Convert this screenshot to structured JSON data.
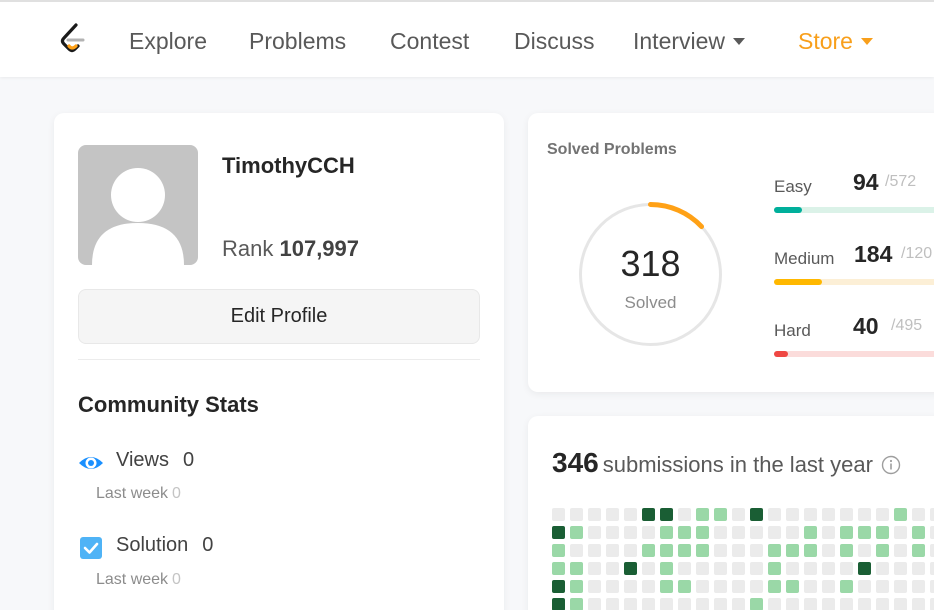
{
  "nav": {
    "items": [
      "Explore",
      "Problems",
      "Contest",
      "Discuss",
      "Interview",
      "Store"
    ],
    "accent": "#f89f1b"
  },
  "profile": {
    "username": "TimothyCCH",
    "rank_label": "Rank",
    "rank_value": "107,997",
    "edit_label": "Edit Profile"
  },
  "community": {
    "title": "Community Stats",
    "stats": [
      {
        "label": "Views",
        "value": "0",
        "sub_label": "Last week",
        "sub_value": "0",
        "icon": "eye-icon",
        "color": "#1a90ff"
      },
      {
        "label": "Solution",
        "value": "0",
        "sub_label": "Last week",
        "sub_value": "0",
        "icon": "checkbox-icon",
        "color": "#4fb3f6"
      }
    ]
  },
  "solved": {
    "title": "Solved Problems",
    "total": "318",
    "total_label": "Solved",
    "ring_fraction": 0.13,
    "ring_color": "#ffa116",
    "difficulties": [
      {
        "label": "Easy",
        "count": "94",
        "total": "/572",
        "fraction": 0.165,
        "color": "#00af9b",
        "track": "#dbf2e8"
      },
      {
        "label": "Medium",
        "count": "184",
        "total": "/120",
        "fraction": 0.28,
        "color": "#ffb800",
        "track": "#fcefd6"
      },
      {
        "label": "Hard",
        "count": "40",
        "total": "/495",
        "fraction": 0.081,
        "color": "#ef4743",
        "track": "#fbdcdb"
      }
    ]
  },
  "submissions": {
    "count": "346",
    "text": "submissions in the last year",
    "levels": [
      "#ebebeb",
      "#9ad8a7",
      "#1a5e34"
    ],
    "weeks": [
      [
        0,
        2,
        1,
        1,
        2,
        2,
        1
      ],
      [
        0,
        1,
        0,
        1,
        1,
        1,
        1
      ],
      [
        0,
        0,
        0,
        0,
        0,
        0,
        0
      ],
      [
        0,
        0,
        0,
        0,
        0,
        0,
        0
      ],
      [
        0,
        0,
        0,
        2,
        0,
        0,
        0
      ],
      [
        2,
        0,
        1,
        0,
        0,
        0,
        0
      ],
      [
        2,
        1,
        1,
        1,
        1,
        0,
        0
      ],
      [
        0,
        1,
        1,
        0,
        1,
        0,
        0
      ],
      [
        1,
        1,
        1,
        0,
        0,
        0,
        0
      ],
      [
        1,
        0,
        0,
        0,
        0,
        0,
        0
      ],
      [
        0,
        0,
        0,
        0,
        0,
        0,
        2
      ],
      [
        2,
        0,
        0,
        0,
        0,
        1,
        0
      ],
      [
        0,
        0,
        1,
        1,
        1,
        0,
        0
      ],
      [
        0,
        0,
        1,
        0,
        1,
        0,
        0
      ],
      [
        0,
        1,
        1,
        0,
        0,
        0,
        0
      ],
      [
        0,
        0,
        0,
        0,
        0,
        0,
        0
      ],
      [
        0,
        1,
        1,
        0,
        1,
        0,
        0
      ],
      [
        0,
        1,
        0,
        2,
        0,
        0,
        0
      ],
      [
        0,
        1,
        1,
        0,
        0,
        0,
        0
      ],
      [
        1,
        0,
        0,
        0,
        0,
        0,
        0
      ],
      [
        0,
        1,
        1,
        0,
        0,
        0,
        0
      ],
      [
        0,
        0,
        0,
        0,
        0,
        0,
        0
      ],
      [
        0,
        0,
        0,
        0,
        0,
        0,
        0
      ]
    ]
  }
}
